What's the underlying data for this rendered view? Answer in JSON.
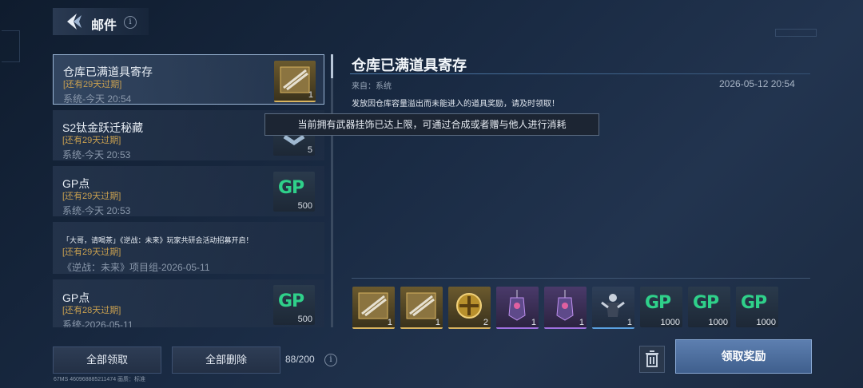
{
  "header": {
    "title": "邮件",
    "info": "i"
  },
  "mails": [
    {
      "title": "仓库已满道具寄存",
      "expiry": "[还有29天过期]",
      "meta": "系统-今天 20:54",
      "thumb": "weapon-attachment-icon",
      "count": "1",
      "selected": true
    },
    {
      "title": "S2钛金跃迁秘藏",
      "expiry": "[还有29天过期]",
      "meta": "系统-今天 20:53",
      "thumb": "chest-icon",
      "count": "5"
    },
    {
      "title": "GP点",
      "expiry": "[还有29天过期]",
      "meta": "系统-今天 20:53",
      "thumb": "gp-icon",
      "count": "500"
    },
    {
      "title": "「大哥，请喝茶」《逆战：未来》玩家共研会活动招募开启！",
      "expiry": "[还有29天过期]",
      "meta": "《逆战：未来》项目组-2026-05-11"
    },
    {
      "title": "GP点",
      "expiry": "[还有28天过期]",
      "meta": "系统-2026-05-11",
      "thumb": "gp-icon",
      "count": "500"
    }
  ],
  "detail": {
    "title": "仓库已满道具寄存",
    "from": "来自：系统",
    "date": "2026-05-12 20:54",
    "body": "发放因仓库容量溢出而未能进入的道具奖励，请及时领取！"
  },
  "tooltip": "当前拥有武器挂饰已达上限，可通过合成或者赠与他人进行消耗",
  "rewards": [
    {
      "icon": "weapon-attachment-icon",
      "count": "1",
      "rarity": "gold"
    },
    {
      "icon": "weapon-attachment-icon",
      "count": "1",
      "rarity": "gold"
    },
    {
      "icon": "medal-icon",
      "count": "2",
      "rarity": "gold"
    },
    {
      "icon": "charm-icon",
      "count": "1",
      "rarity": "purple"
    },
    {
      "icon": "charm-icon",
      "count": "1",
      "rarity": "purple"
    },
    {
      "icon": "figure-icon",
      "count": "1",
      "rarity": "blue"
    },
    {
      "icon": "gp-icon",
      "count": "1000",
      "label": "GP",
      "rarity": "dark"
    },
    {
      "icon": "gp-icon",
      "count": "1000",
      "label": "GP",
      "rarity": "dark"
    },
    {
      "icon": "gp-icon",
      "count": "1000",
      "label": "GP",
      "rarity": "dark"
    }
  ],
  "actions": {
    "claim_all": "全部领取",
    "delete_all": "全部删除",
    "mail_count": "88/200",
    "claim_reward": "领取奖励",
    "info": "i"
  },
  "status": "67MS  460968885211474    画质：标准",
  "colors": {
    "accent": "#5d7fb0",
    "expiry": "#c9a050",
    "gp": "#2fd08a",
    "purple": "#a070e0",
    "gold": "#d8b460"
  }
}
